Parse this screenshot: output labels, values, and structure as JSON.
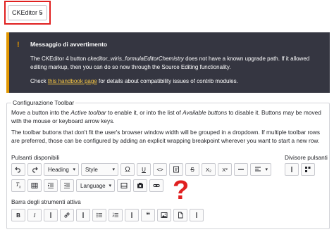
{
  "editor_select": {
    "value": "CKEditor 5"
  },
  "warning": {
    "title": "Messaggio di avvertimento",
    "body_1": "The CKEditor 4 button ",
    "body_em": "ckeditor_wiris_formulaEditorChemistry",
    "body_2": " does not have a known upgrade path. If it allowed editing markup, then you can do so now through the Source Editing functionality.",
    "check_prefix": "Check ",
    "link": "this handbook page",
    "check_suffix": " for details about compatibility issues of contrib modules."
  },
  "toolbar_config": {
    "legend": "Configurazione Toolbar",
    "desc1_a": "Move a button into the ",
    "desc1_em1": "Active toolbar",
    "desc1_b": " to enable it, or into the list of ",
    "desc1_em2": "Available buttons",
    "desc1_c": " to disable it. Buttons may be moved with the mouse or keyboard arrow keys.",
    "desc2": "The toolbar buttons that don't fit the user's browser window width will be grouped in a dropdown. If multiple toolbar rows are preferred, those can be configured by adding an explicit wrapping breakpoint wherever you want to start a new row.",
    "available_label": "Pulsanti disponibili",
    "dividers_label": "Divisore pulsanti",
    "active_label": "Barra degli strumenti attiva",
    "heading_label": "Heading",
    "style_label": "Style",
    "language_label": "Language",
    "omega": "Ω",
    "underline": "U",
    "code": "<>",
    "subscript": "X₂",
    "superscript": "X²",
    "bold": "B",
    "italic": "I",
    "blockquote": "❝",
    "question_mark": "?"
  },
  "colors": {
    "warning_bg": "#353641",
    "warning_accent": "#e29700",
    "highlight": "#e02020",
    "link": "#f5c542"
  }
}
